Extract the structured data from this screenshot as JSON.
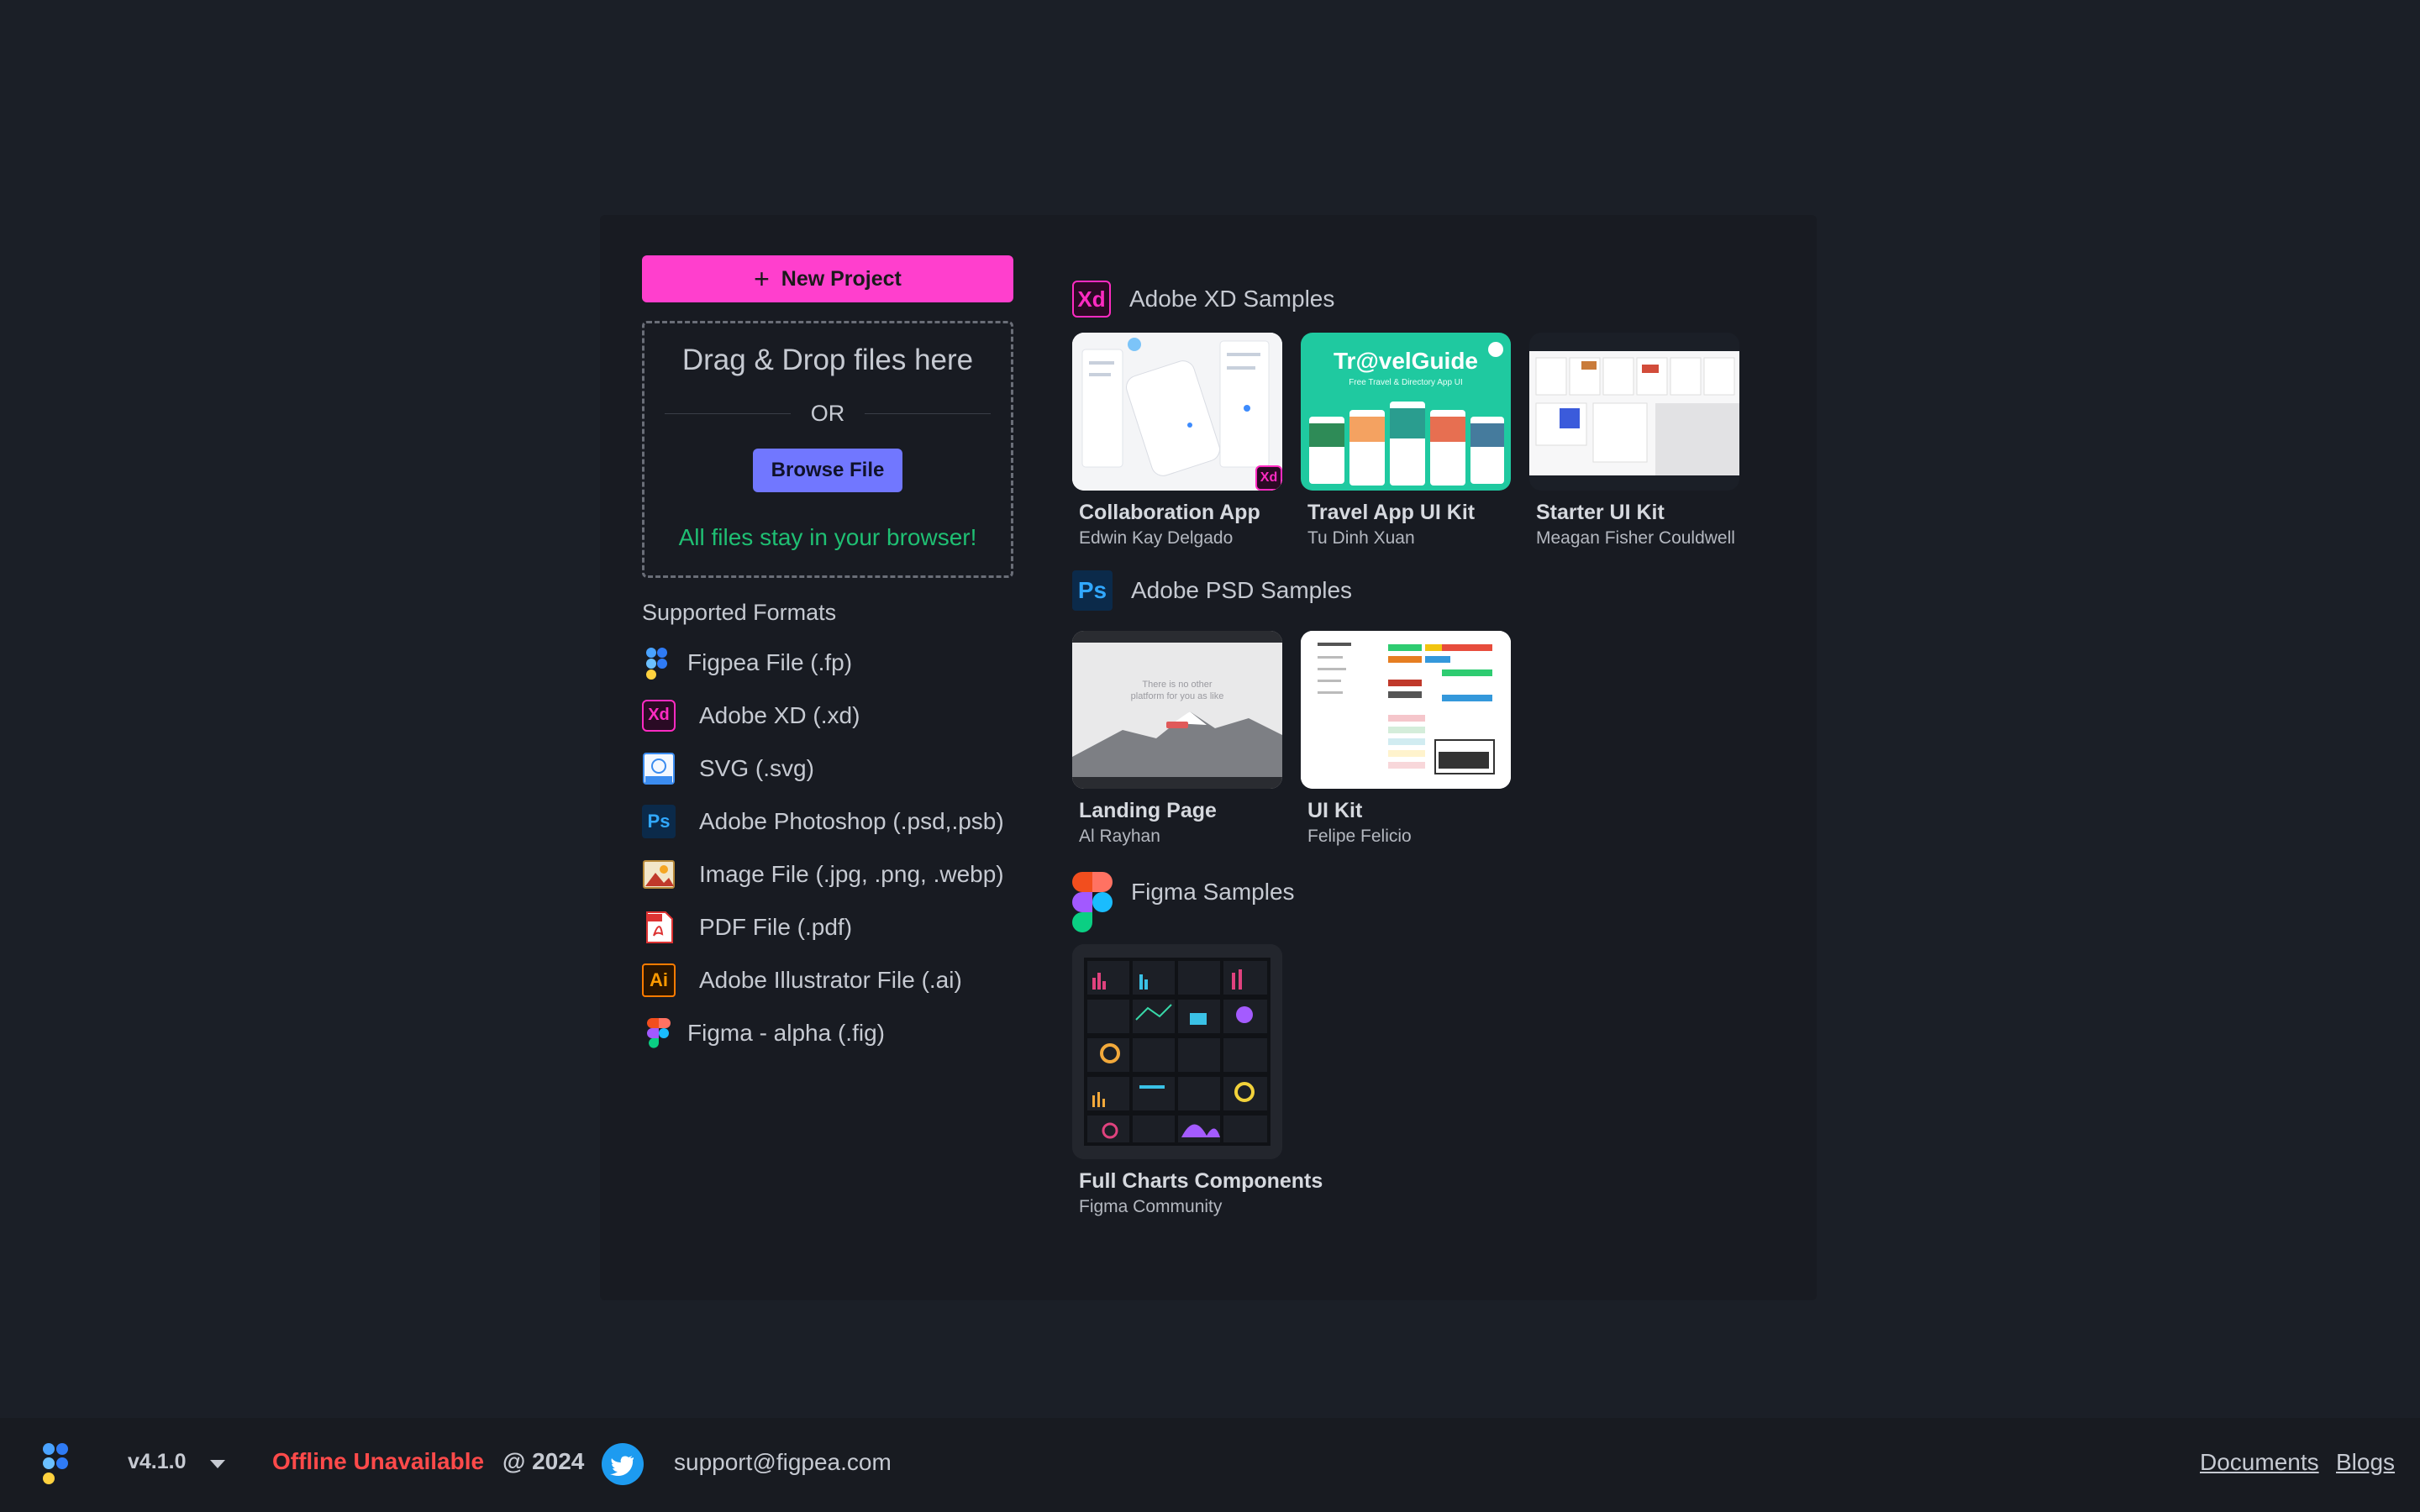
{
  "left": {
    "new_project_label": "New Project",
    "dropzone": {
      "title": "Drag & Drop files here",
      "or": "OR",
      "browse_label": "Browse File",
      "note": "All files stay in your browser!"
    },
    "formats_title": "Supported Formats",
    "formats": [
      {
        "icon": "figpea-icon",
        "label": "Figpea File (.fp)"
      },
      {
        "icon": "adobe-xd-icon",
        "label": "Adobe XD (.xd)"
      },
      {
        "icon": "svg-file-icon",
        "label": "SVG (.svg)"
      },
      {
        "icon": "photoshop-icon",
        "label": "Adobe Photoshop (.psd,.psb)"
      },
      {
        "icon": "image-file-icon",
        "label": "Image File (.jpg, .png, .webp)"
      },
      {
        "icon": "pdf-file-icon",
        "label": "PDF File (.pdf)"
      },
      {
        "icon": "illustrator-icon",
        "label": "Adobe Illustrator File (.ai)"
      },
      {
        "icon": "figma-icon",
        "label": "Figma - alpha (.fig)"
      }
    ]
  },
  "samples": {
    "xd": {
      "title": "Adobe XD Samples",
      "items": [
        {
          "name": "Collaboration App",
          "author": "Edwin Kay Delgado"
        },
        {
          "name": "Travel App UI Kit",
          "author": "Tu Dinh Xuan"
        },
        {
          "name": "Starter UI Kit",
          "author": "Meagan Fisher Couldwell"
        }
      ]
    },
    "psd": {
      "title": "Adobe PSD Samples",
      "items": [
        {
          "name": "Landing Page",
          "author": "Al Rayhan"
        },
        {
          "name": "UI Kit",
          "author": "Felipe Felicio"
        }
      ]
    },
    "figma": {
      "title": "Figma Samples",
      "items": [
        {
          "name": "Full Charts Components",
          "author": "Figma Community"
        }
      ]
    }
  },
  "badges": {
    "xd": "Xd",
    "ps": "Ps",
    "ai": "Ai",
    "svg": "SVG",
    "pdf": "PDF"
  },
  "thumb_text": {
    "travel_title": "Tr@velGuide",
    "travel_sub": "Free Travel & Directory App UI",
    "landing_line1": "There is no other",
    "landing_line2": "platform for you as like"
  },
  "footer": {
    "version": "v4.1.0",
    "status": "Offline Unavailable",
    "year": "@ 2024",
    "support": "support@figpea.com",
    "documents": "Documents",
    "blogs": "Blogs"
  },
  "colors": {
    "accent_pink": "#ff3fcd",
    "browse_blue": "#7177ff",
    "note_green": "#1fbf73",
    "offline_red": "#ff4a4a",
    "twitter_blue": "#1d9bf0"
  }
}
